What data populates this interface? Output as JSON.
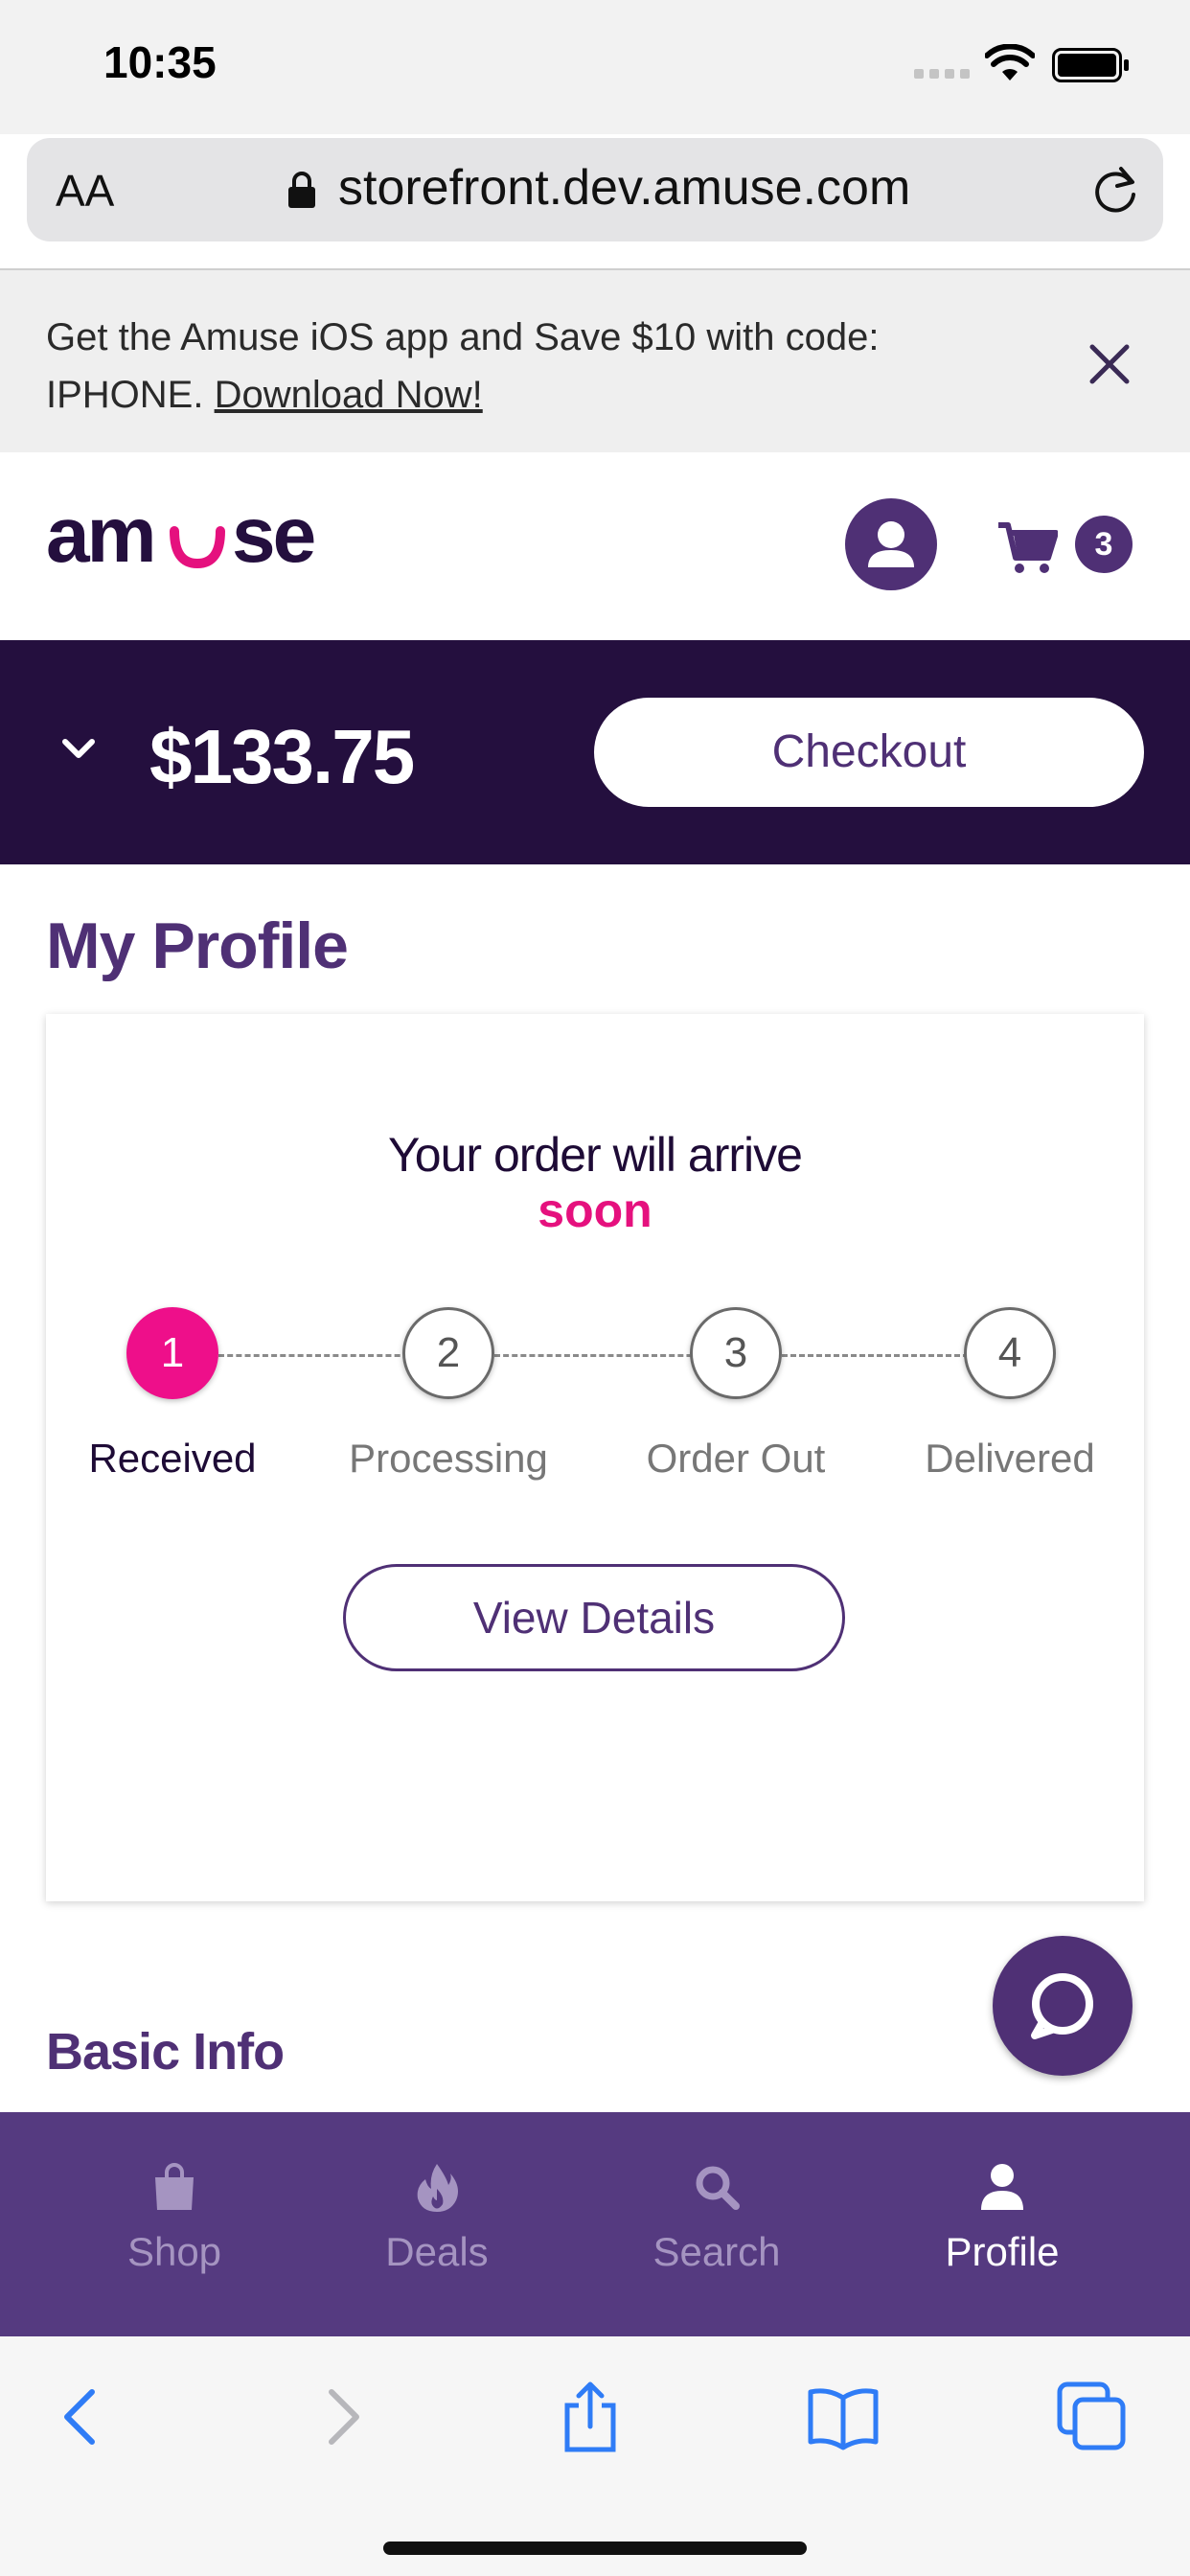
{
  "status_bar": {
    "time": "10:35"
  },
  "browser": {
    "text_size_label": "AA",
    "url": "storefront.dev.amuse.com"
  },
  "app_banner": {
    "text": "Get the Amuse iOS app and Save $10 with code: IPHONE.",
    "link": "Download Now!"
  },
  "header": {
    "logo": "amuse",
    "cart_count": "3"
  },
  "cart_bar": {
    "total": "$133.75",
    "checkout_label": "Checkout"
  },
  "profile": {
    "title": "My Profile",
    "order": {
      "heading": "Your order will arrive",
      "heading_accent": "soon",
      "steps": [
        {
          "number": "1",
          "label": "Received",
          "active": true
        },
        {
          "number": "2",
          "label": "Processing",
          "active": false
        },
        {
          "number": "3",
          "label": "Order Out",
          "active": false
        },
        {
          "number": "4",
          "label": "Delivered",
          "active": false
        }
      ],
      "details_button": "View Details"
    },
    "basic_info_title": "Basic Info"
  },
  "tabs": [
    {
      "label": "Shop",
      "icon": "shopping-bag-icon",
      "active": false
    },
    {
      "label": "Deals",
      "icon": "flame-icon",
      "active": false
    },
    {
      "label": "Search",
      "icon": "search-icon",
      "active": false
    },
    {
      "label": "Profile",
      "icon": "person-icon",
      "active": true
    }
  ],
  "colors": {
    "brand_purple": "#4f3075",
    "dark_purple": "#240f3e",
    "accent_pink": "#e5117e",
    "tab_bar": "#553a80"
  }
}
